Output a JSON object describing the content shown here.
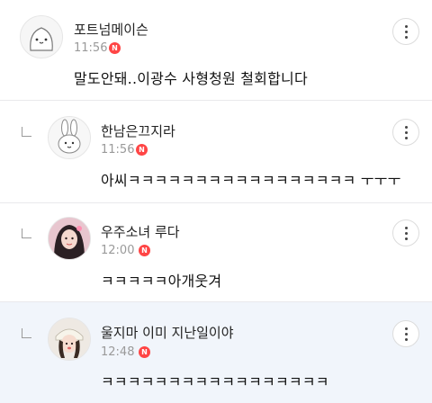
{
  "comments": [
    {
      "nickname": "포트넘메이슨",
      "time": "11:56",
      "badge": "N",
      "text": "말도안돼..이광수 사형청원 철회합니다",
      "avatar": "blob-character-avatar",
      "is_reply": false,
      "highlighted": false
    },
    {
      "nickname": "한남은끄지라",
      "time": "11:56",
      "badge": "N",
      "text": "아씨ㅋㅋㅋㅋㅋㅋㅋㅋㅋㅋㅋㅋㅋㅋㅋㅋㅋ ㅜㅜㅜ",
      "avatar": "bunny-character-avatar",
      "is_reply": true,
      "highlighted": false
    },
    {
      "nickname": "우주소녀 루다",
      "time": "12:00",
      "badge": "N",
      "text": "ㅋㅋㅋㅋㅋ아개웃겨",
      "avatar": "profile-photo-avatar",
      "is_reply": true,
      "highlighted": false
    },
    {
      "nickname": "울지마 이미 지난일이야",
      "time": "12:48",
      "badge": "N",
      "text": "ㅋㅋㅋㅋㅋㅋㅋㅋㅋㅋㅋㅋㅋㅋㅋㅋㅋ",
      "avatar": "profile-photo-avatar",
      "is_reply": true,
      "highlighted": true
    }
  ],
  "colors": {
    "badge": "#ff4545",
    "highlight_bg": "#f1f5fb",
    "divider": "#e9e9ec",
    "time_text": "#9a9a9a"
  },
  "icons": {
    "more": "more-vertical-icon",
    "reply": "reply-indent-icon"
  }
}
